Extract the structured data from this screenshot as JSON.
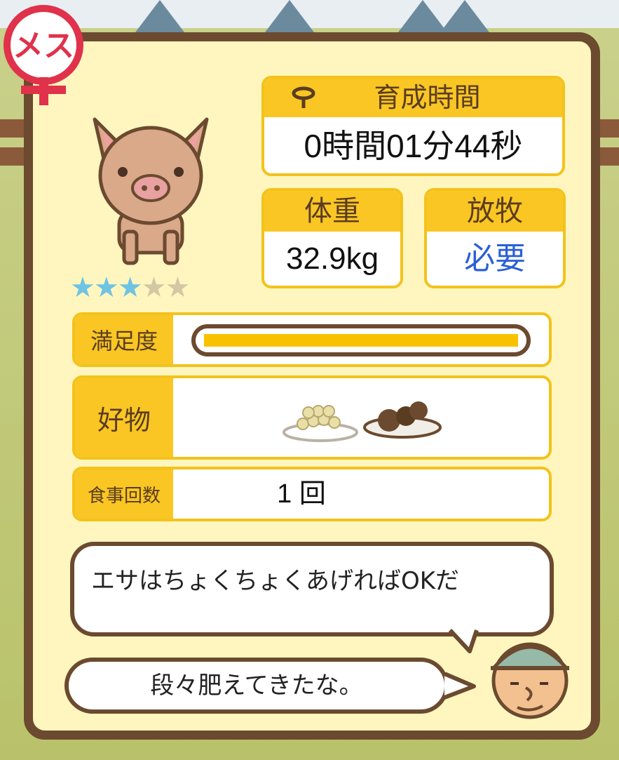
{
  "badge": {
    "text": "メス",
    "color": "#e0324b"
  },
  "rating": {
    "filled": 3,
    "total": 5,
    "on_color": "#6fc3e3",
    "off_color": "#d2c8a4"
  },
  "raising_time": {
    "icon": "rope-lasso-icon",
    "label": "育成時間",
    "value": "0時間01分44秒"
  },
  "weight": {
    "label": "体重",
    "value": "32.9kg"
  },
  "grazing": {
    "label": "放牧",
    "value": "必要",
    "value_color": "#2a5fd8"
  },
  "satisfaction": {
    "label": "満足度",
    "level": 1.0,
    "bar_color": "#f9c200"
  },
  "favorite_food": {
    "label": "好物",
    "items": [
      "grain-plate-icon",
      "meatball-plate-icon"
    ]
  },
  "meal_count": {
    "label": "食事回数",
    "value": "1 回"
  },
  "speech": {
    "farmer_tip": "エサはちょくちょくあげればOKだ",
    "farmer_comment": "段々肥えてきたな。"
  }
}
